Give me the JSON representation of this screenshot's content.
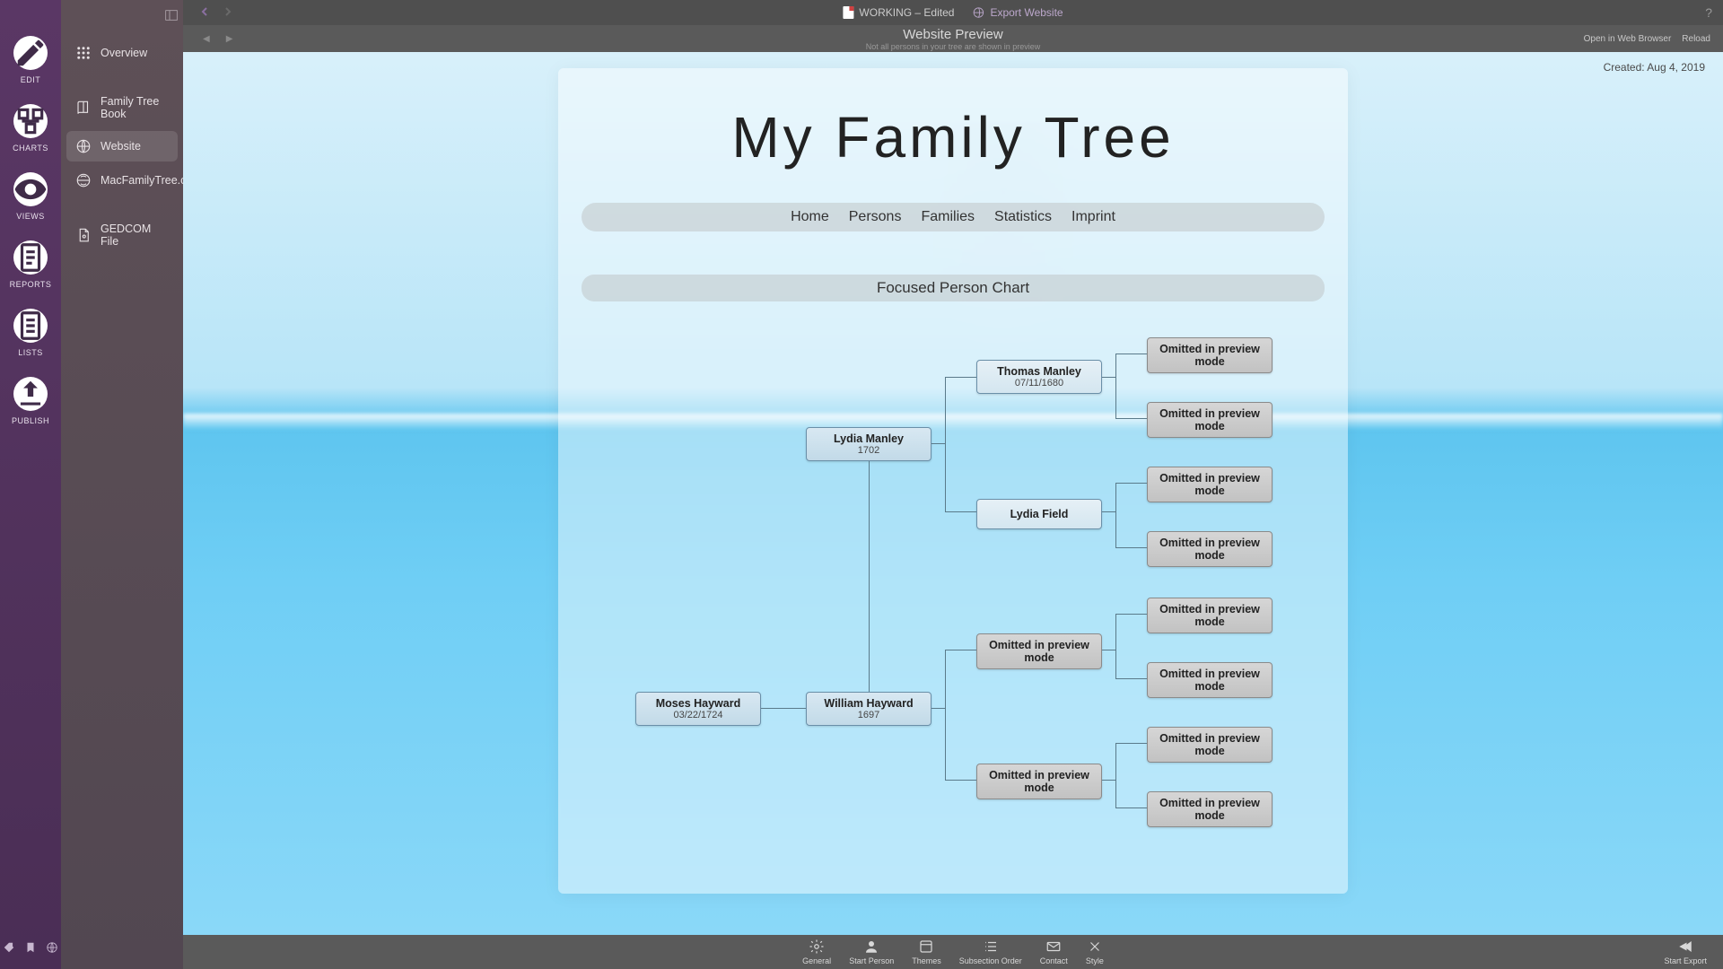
{
  "rail": {
    "items": [
      {
        "label": "EDIT"
      },
      {
        "label": "CHARTS"
      },
      {
        "label": "VIEWS"
      },
      {
        "label": "REPORTS"
      },
      {
        "label": "LISTS"
      },
      {
        "label": "PUBLISH"
      }
    ]
  },
  "side": {
    "items": [
      {
        "label": "Overview"
      },
      {
        "label": "Family Tree Book"
      },
      {
        "label": "Website"
      },
      {
        "label": "MacFamilyTree.com"
      },
      {
        "label": "GEDCOM File"
      }
    ]
  },
  "titlebar": {
    "doc": "WORKING – Edited",
    "export": "Export Website"
  },
  "subbar": {
    "title": "Website Preview",
    "note": "Not all persons in your tree are shown in preview",
    "open": "Open in Web Browser",
    "reload": "Reload"
  },
  "preview": {
    "created_prefix": "Created: ",
    "created_date": "Aug 4, 2019",
    "title": "My Family Tree",
    "nav": [
      "Home",
      "Persons",
      "Families",
      "Statistics",
      "Imprint"
    ],
    "section": "Focused Person Chart",
    "omitted": "Omitted in preview mode",
    "persons": {
      "moses": {
        "name": "Moses Hayward",
        "date": "03/22/1724"
      },
      "william": {
        "name": "William Hayward",
        "date": "1697"
      },
      "lydia_m": {
        "name": "Lydia Manley",
        "date": "1702"
      },
      "thomas": {
        "name": "Thomas Manley",
        "date": "07/11/1680"
      },
      "lydia_f": {
        "name": "Lydia Field"
      }
    }
  },
  "bottom": {
    "items": [
      "General",
      "Start Person",
      "Themes",
      "Subsection Order",
      "Contact",
      "Style"
    ],
    "export": "Start Export"
  }
}
